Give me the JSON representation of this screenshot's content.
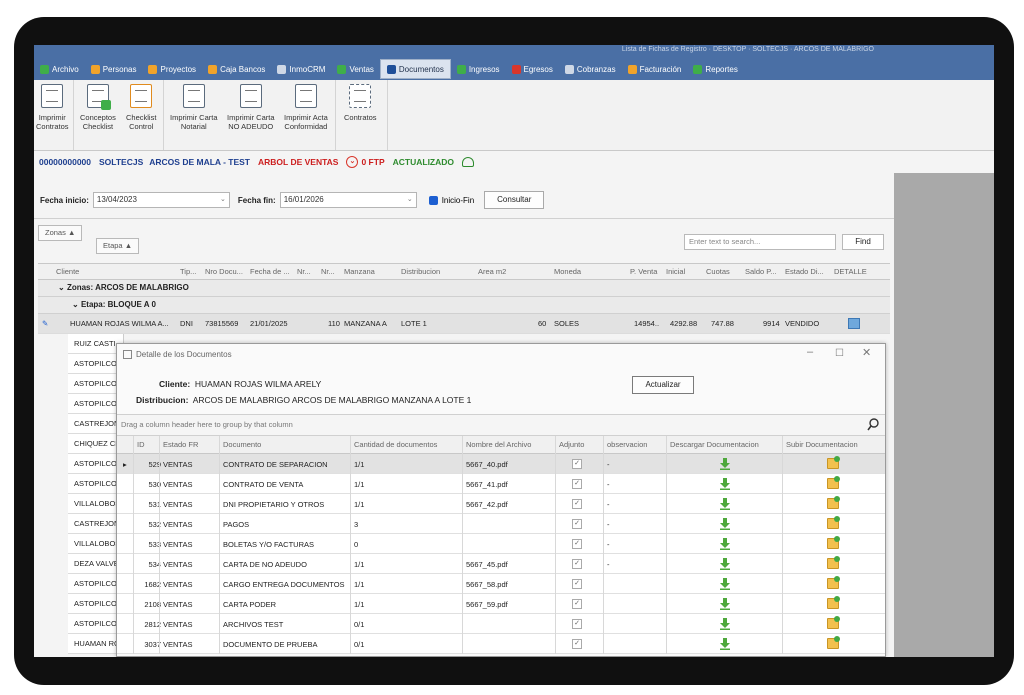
{
  "window": {
    "title_text": "Lista de Fichas de Registro · DESKTOP · SOLTECJS · ARCOS DE MALABRIGO"
  },
  "menu": {
    "items": [
      {
        "label": "Archivo",
        "color": "#3fae49"
      },
      {
        "label": "Personas",
        "color": "#f0a32b"
      },
      {
        "label": "Proyectos",
        "color": "#f0a32b"
      },
      {
        "label": "Caja Bancos",
        "color": "#f0a32b"
      },
      {
        "label": "InmoCRM",
        "color": "#cfd8e6"
      },
      {
        "label": "Ventas",
        "color": "#3fae49"
      },
      {
        "label": "Documentos",
        "color": "#1f4f99"
      },
      {
        "label": "Ingresos",
        "color": "#3fae49"
      },
      {
        "label": "Egresos",
        "color": "#d9362b"
      },
      {
        "label": "Cobranzas",
        "color": "#cfd8e6"
      },
      {
        "label": "Facturación",
        "color": "#f0a32b"
      },
      {
        "label": "Reportes",
        "color": "#3fae49"
      }
    ]
  },
  "ribbon": {
    "buttons": [
      {
        "line1": "Imprimir",
        "line2": "Contratos"
      },
      {
        "line1": "Conceptos",
        "line2": "Checklist"
      },
      {
        "line1": "Checklist",
        "line2": "Control"
      },
      {
        "line1": "Imprimir Carta",
        "line2": "Notarial"
      },
      {
        "line1": "Imprimir Carta",
        "line2": "NO ADEUDO"
      },
      {
        "line1": "Imprimir Acta",
        "line2": "Conformidad"
      },
      {
        "line1": "Contratos",
        "line2": ""
      }
    ]
  },
  "status": {
    "code": "00000000000",
    "company": "SOLTECJS",
    "project": "ARCOS DE MALA - TEST",
    "branch": "ARBOL DE VENTAS",
    "ftp": "0 FTP",
    "updated": "ACTUALIZADO"
  },
  "filters": {
    "start_label": "Fecha inicio:",
    "start_value": "13/04/2023",
    "end_label": "Fecha fin:",
    "end_value": "16/01/2026",
    "checkbox_label": "Inicio-Fin",
    "consult_button": "Consultar",
    "group_zonas": "Zonas",
    "group_etapa": "Etapa",
    "search_placeholder": "Enter text to search...",
    "find_button": "Find"
  },
  "main_grid": {
    "columns": [
      "Cliente",
      "Tip...",
      "Nro Docu...",
      "Fecha de ...",
      "Nr...",
      "Nr...",
      "Manzana",
      "Distribucion",
      "Area m2",
      "Moneda",
      "P. Venta",
      "Inicial",
      "Cuotas",
      "Saldo P...",
      "Estado Di...",
      "DETALLE"
    ],
    "group_zona": "Zonas: ARCOS DE MALABRIGO",
    "group_etapa": "Etapa: BLOQUE A 0",
    "first_row": {
      "cliente": "HUAMAN ROJAS WILMA A...",
      "tipo": "DNI",
      "nro": "73815569",
      "fecha": "21/01/2025",
      "nr": "110",
      "manzana": "MANZANA A",
      "distribucion": "LOTE 1",
      "area": "60",
      "moneda": "SOLES",
      "pventa": "14954..",
      "inicial": "4292.88",
      "cuotas": "747.88",
      "saldo": "9914",
      "estado": "VENDIDO"
    },
    "names": [
      "RUIZ CASTI",
      "ASTOPILCO",
      "ASTOPILCO",
      "ASTOPILCO",
      "CASTREJON",
      "CHIQUEZ CF",
      "ASTOPILCO",
      "ASTOPILCO",
      "VILLALOBOS",
      "CASTREJON",
      "VILLALOBOS",
      "DEZA VALVE",
      "ASTOPILCO",
      "ASTOPILCO",
      "ASTOPILCO",
      "HUAMAN RC"
    ]
  },
  "dialog": {
    "title": "Detalle de los Documentos",
    "cliente_label": "Cliente:",
    "cliente_value": "HUAMAN ROJAS WILMA ARELY",
    "distribucion_label": "Distribucion:",
    "distribucion_value": "ARCOS DE MALABRIGO  ARCOS DE MALABRIGO  MANZANA A LOTE 1",
    "update_button": "Actualizar",
    "drag_hint": "Drag a column header here to group by that column",
    "columns": [
      "ID",
      "Estado FR",
      "Documento",
      "Cantidad de documentos",
      "Nombre del Archivo",
      "Adjunto",
      "observacion",
      "Descargar Documentacion",
      "Subir Documentacion"
    ],
    "rows": [
      {
        "id": "529",
        "estado": "VENTAS",
        "documento": "CONTRATO DE SEPARACION",
        "cantidad": "1/1",
        "archivo": "5667_40.pdf",
        "obs": "-"
      },
      {
        "id": "530",
        "estado": "VENTAS",
        "documento": "CONTRATO DE VENTA",
        "cantidad": "1/1",
        "archivo": "5667_41.pdf",
        "obs": "-"
      },
      {
        "id": "531",
        "estado": "VENTAS",
        "documento": "DNI PROPIETARIO Y OTROS",
        "cantidad": "1/1",
        "archivo": "5667_42.pdf",
        "obs": "-"
      },
      {
        "id": "532",
        "estado": "VENTAS",
        "documento": "PAGOS",
        "cantidad": "3",
        "archivo": "",
        "obs": "-"
      },
      {
        "id": "533",
        "estado": "VENTAS",
        "documento": "BOLETAS Y/O FACTURAS",
        "cantidad": "0",
        "archivo": "",
        "obs": "-"
      },
      {
        "id": "534",
        "estado": "VENTAS",
        "documento": "CARTA DE NO ADEUDO",
        "cantidad": "1/1",
        "archivo": "5667_45.pdf",
        "obs": "-"
      },
      {
        "id": "1682",
        "estado": "VENTAS",
        "documento": "CARGO ENTREGA DOCUMENTOS",
        "cantidad": "1/1",
        "archivo": "5667_58.pdf",
        "obs": ""
      },
      {
        "id": "2108",
        "estado": "VENTAS",
        "documento": "CARTA PODER",
        "cantidad": "1/1",
        "archivo": "5667_59.pdf",
        "obs": ""
      },
      {
        "id": "2812",
        "estado": "VENTAS",
        "documento": "ARCHIVOS TEST",
        "cantidad": "0/1",
        "archivo": "",
        "obs": ""
      },
      {
        "id": "3037",
        "estado": "VENTAS",
        "documento": "DOCUMENTO DE PRUEBA",
        "cantidad": "0/1",
        "archivo": "",
        "obs": ""
      }
    ]
  }
}
